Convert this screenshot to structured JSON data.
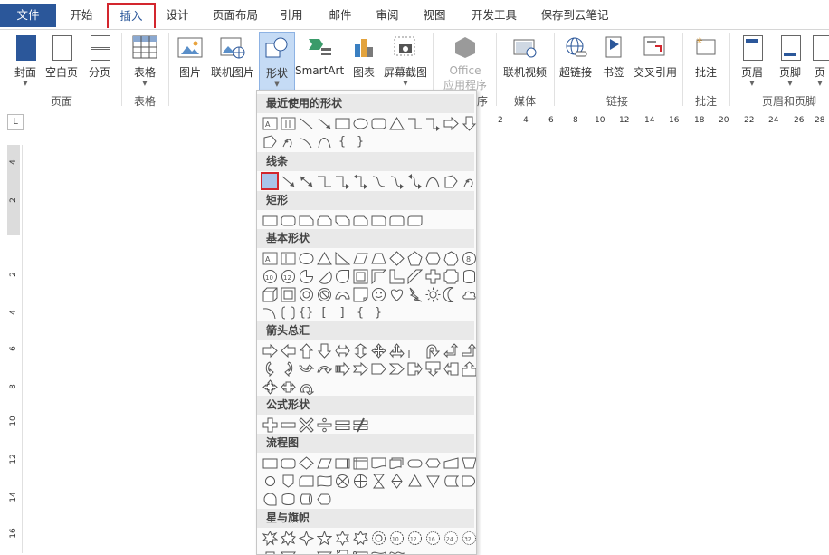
{
  "menubar": {
    "tabs": [
      "文件",
      "开始",
      "插入",
      "设计",
      "页面布局",
      "引用",
      "邮件",
      "审阅",
      "视图",
      "开发工具",
      "保存到云笔记"
    ]
  },
  "ribbon": {
    "buttons": {
      "cover": "封面",
      "blank_page": "空白页",
      "page_break": "分页",
      "table": "表格",
      "picture": "图片",
      "online_picture": "联机图片",
      "shapes": "形状",
      "smartart": "SmartArt",
      "chart": "图表",
      "screenshot": "屏幕截图",
      "office_apps_1": "Office",
      "office_apps_2": "应用程序",
      "online_video": "联机视频",
      "hyperlink": "超链接",
      "bookmark": "书签",
      "cross_ref": "交叉引用",
      "comment": "批注",
      "header": "页眉",
      "footer": "页脚",
      "page_number": "页"
    },
    "groups": {
      "pages": "页面",
      "tables": "表格",
      "apps_partial": "序",
      "media": "媒体",
      "links": "链接",
      "comments": "批注",
      "header_footer": "页眉和页脚"
    }
  },
  "ruler": {
    "top_ticks": [
      "2",
      "4",
      "6",
      "8",
      "10",
      "12",
      "14",
      "16",
      "18",
      "20",
      "22",
      "24",
      "26",
      "28"
    ],
    "left_ticks": [
      "4",
      "2",
      "",
      "2",
      "4",
      "6",
      "8",
      "10",
      "12",
      "14",
      "16"
    ],
    "corner": "L"
  },
  "gallery": {
    "sections": {
      "recent": "最近使用的形状",
      "lines": "线条",
      "rectangles": "矩形",
      "basic": "基本形状",
      "arrows": "箭头总汇",
      "equation": "公式形状",
      "flowchart": "流程图",
      "stars": "星与旗帜"
    }
  }
}
